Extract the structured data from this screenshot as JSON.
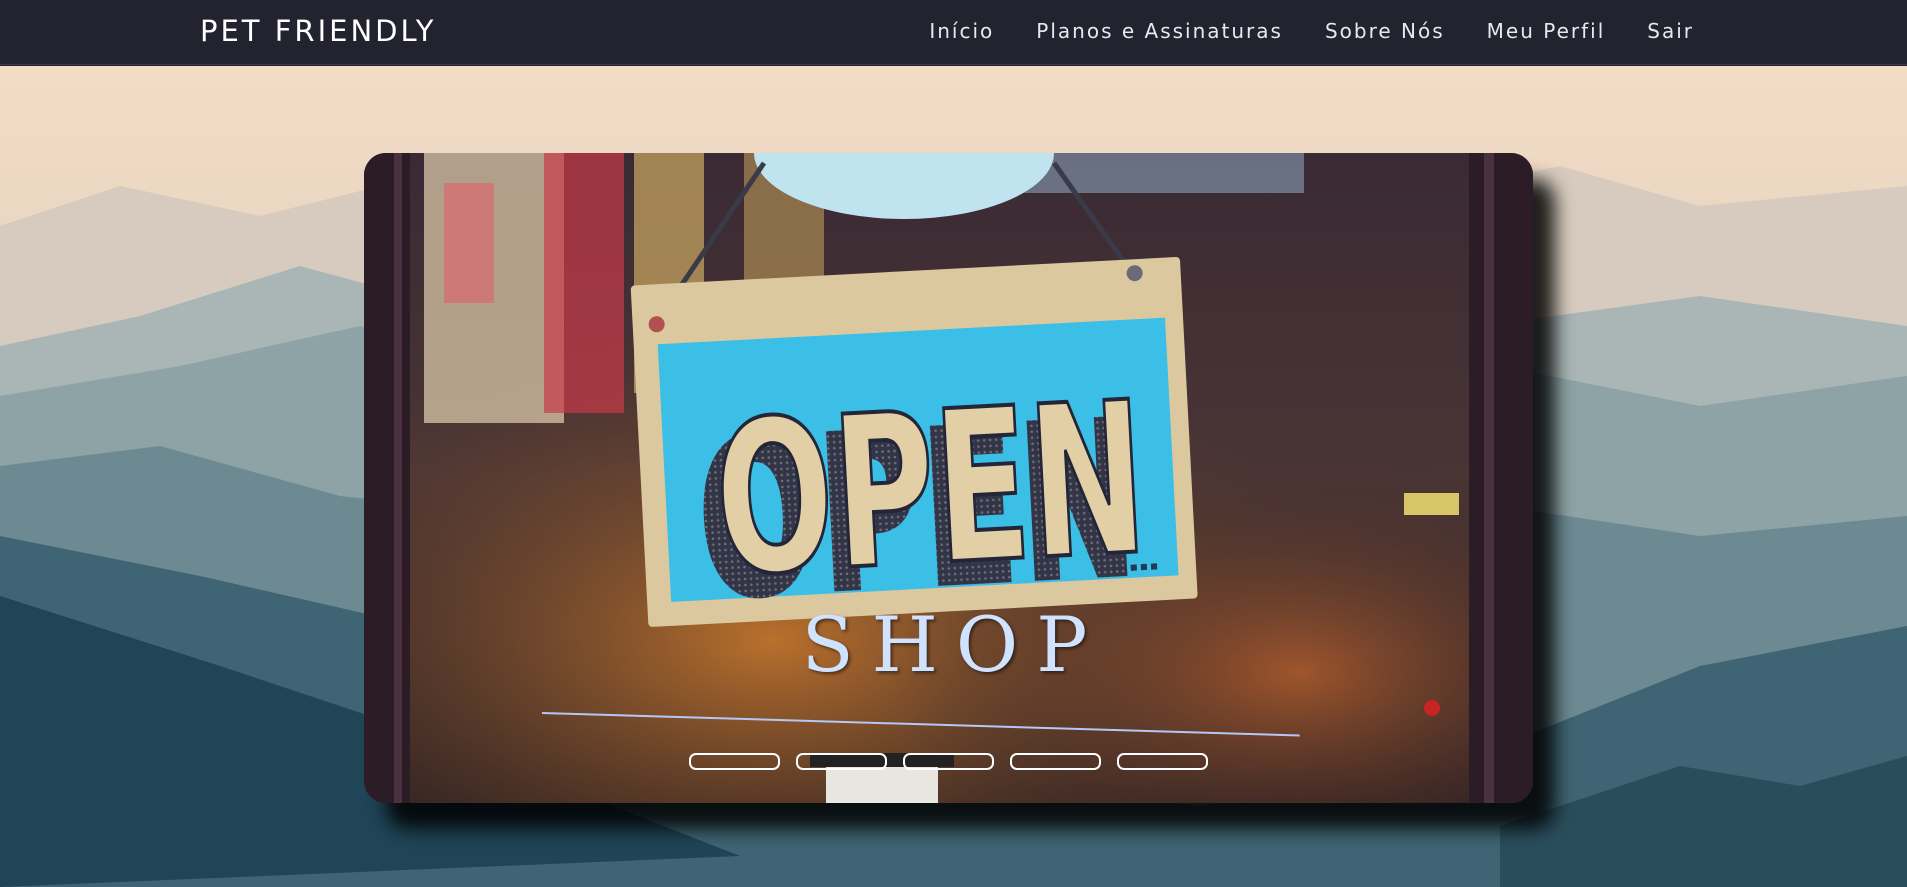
{
  "navbar": {
    "brand": "PET FRIENDLY",
    "links": [
      {
        "label": "Início"
      },
      {
        "label": "Planos e Assinaturas"
      },
      {
        "label": "Sobre Nós"
      },
      {
        "label": "Meu Perfil"
      },
      {
        "label": "Sair"
      }
    ]
  },
  "carousel": {
    "sign_text": "OPEN",
    "caption": "SHOP",
    "indicator_count": 5,
    "active_indicator": 1
  },
  "colors": {
    "navbar_bg": "#22232e",
    "sign_blue": "#3bbfe6",
    "caption": "#cfe2ff"
  }
}
